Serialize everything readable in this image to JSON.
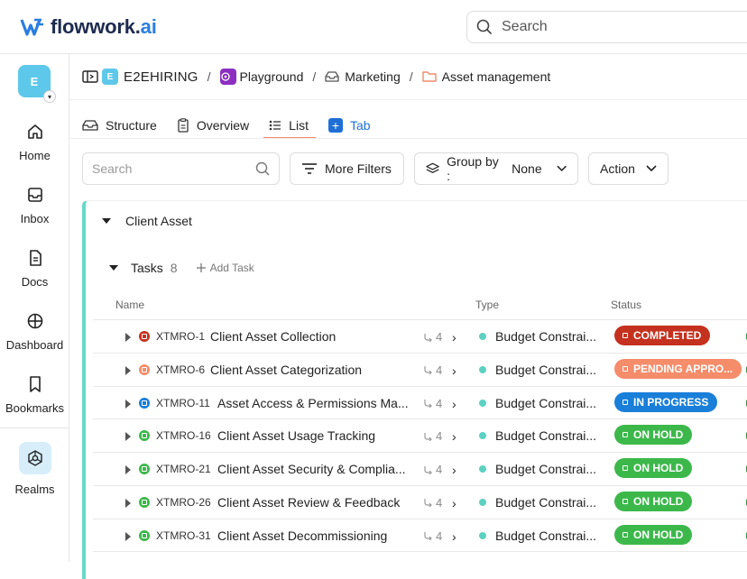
{
  "app": {
    "brand_main": "flowwork.",
    "brand_ai": "ai",
    "search_placeholder": "Search"
  },
  "sidebar": {
    "workspace_initial": "E",
    "items": [
      {
        "label": "Home",
        "icon": "home-icon"
      },
      {
        "label": "Inbox",
        "icon": "inbox-icon"
      },
      {
        "label": "Docs",
        "icon": "docs-icon"
      },
      {
        "label": "Dashboard",
        "icon": "dashboard-icon"
      },
      {
        "label": "Bookmarks",
        "icon": "bookmark-icon"
      },
      {
        "label": "Realms",
        "icon": "realms-icon"
      }
    ]
  },
  "breadcrumb": {
    "org_initial": "E",
    "org": "E2EHIRING",
    "space": "Playground",
    "folder": "Marketing",
    "page": "Asset management"
  },
  "tabs": [
    {
      "label": "Structure",
      "icon": "structure-icon"
    },
    {
      "label": "Overview",
      "icon": "overview-icon"
    },
    {
      "label": "List",
      "icon": "list-icon",
      "active": true
    },
    {
      "label": "Tab",
      "icon": "add-tab-icon"
    }
  ],
  "filters": {
    "search_placeholder": "Search",
    "more_filters": "More Filters",
    "group_by_label": "Group by :",
    "group_by_value": "None",
    "action": "Action"
  },
  "group": {
    "title": "Client Asset",
    "tasks_label": "Tasks",
    "tasks_count": "8",
    "add_task": "Add Task",
    "columns": {
      "name": "Name",
      "type": "Type",
      "status": "Status"
    }
  },
  "rows": [
    {
      "id": "XTMRO-1",
      "name": "Client Asset Collection",
      "subtasks": "4",
      "type": "Budget Constrai...",
      "status": "COMPLETED",
      "status_color": "#c4321f",
      "dot_color": "#c4321f"
    },
    {
      "id": "XTMRO-6",
      "name": "Client Asset Categorization",
      "subtasks": "4",
      "type": "Budget Constrai...",
      "status": "PENDING APPRO...",
      "status_color": "#f58c6a",
      "dot_color": "#f58c6a"
    },
    {
      "id": "XTMRO-11",
      "name": "Asset Access & Permissions Ma...",
      "subtasks": "4",
      "type": "Budget Constrai...",
      "status": "IN PROGRESS",
      "status_color": "#1a7fd9",
      "dot_color": "#1a7fd9"
    },
    {
      "id": "XTMRO-16",
      "name": "Client Asset Usage Tracking",
      "subtasks": "4",
      "type": "Budget Constrai...",
      "status": "ON HOLD",
      "status_color": "#3cb84b",
      "dot_color": "#3cb84b"
    },
    {
      "id": "XTMRO-21",
      "name": "Client Asset Security & Complia...",
      "subtasks": "4",
      "type": "Budget Constrai...",
      "status": "ON HOLD",
      "status_color": "#3cb84b",
      "dot_color": "#3cb84b"
    },
    {
      "id": "XTMRO-26",
      "name": "Client Asset Review & Feedback",
      "subtasks": "4",
      "type": "Budget Constrai...",
      "status": "ON HOLD",
      "status_color": "#3cb84b",
      "dot_color": "#3cb84b"
    },
    {
      "id": "XTMRO-31",
      "name": "Client Asset Decommissioning",
      "subtasks": "4",
      "type": "Budget Constrai...",
      "status": "ON HOLD",
      "status_color": "#3cb84b",
      "dot_color": "#3cb84b"
    }
  ]
}
